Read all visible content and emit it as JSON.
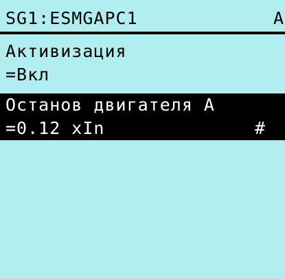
{
  "header": {
    "title": "SG1:ESMGAPC1",
    "suffix": "A"
  },
  "parameters": [
    {
      "name": "Активизация",
      "value": "=Вкл",
      "selected": false
    },
    {
      "name": "Останов двигателя A",
      "value": "=0.12 xIn",
      "marker": "#",
      "selected": true
    }
  ],
  "colors": {
    "background": "#b0eef0",
    "foreground": "#000000",
    "highlight_background": "#000000",
    "highlight_text": "#ffffff"
  }
}
